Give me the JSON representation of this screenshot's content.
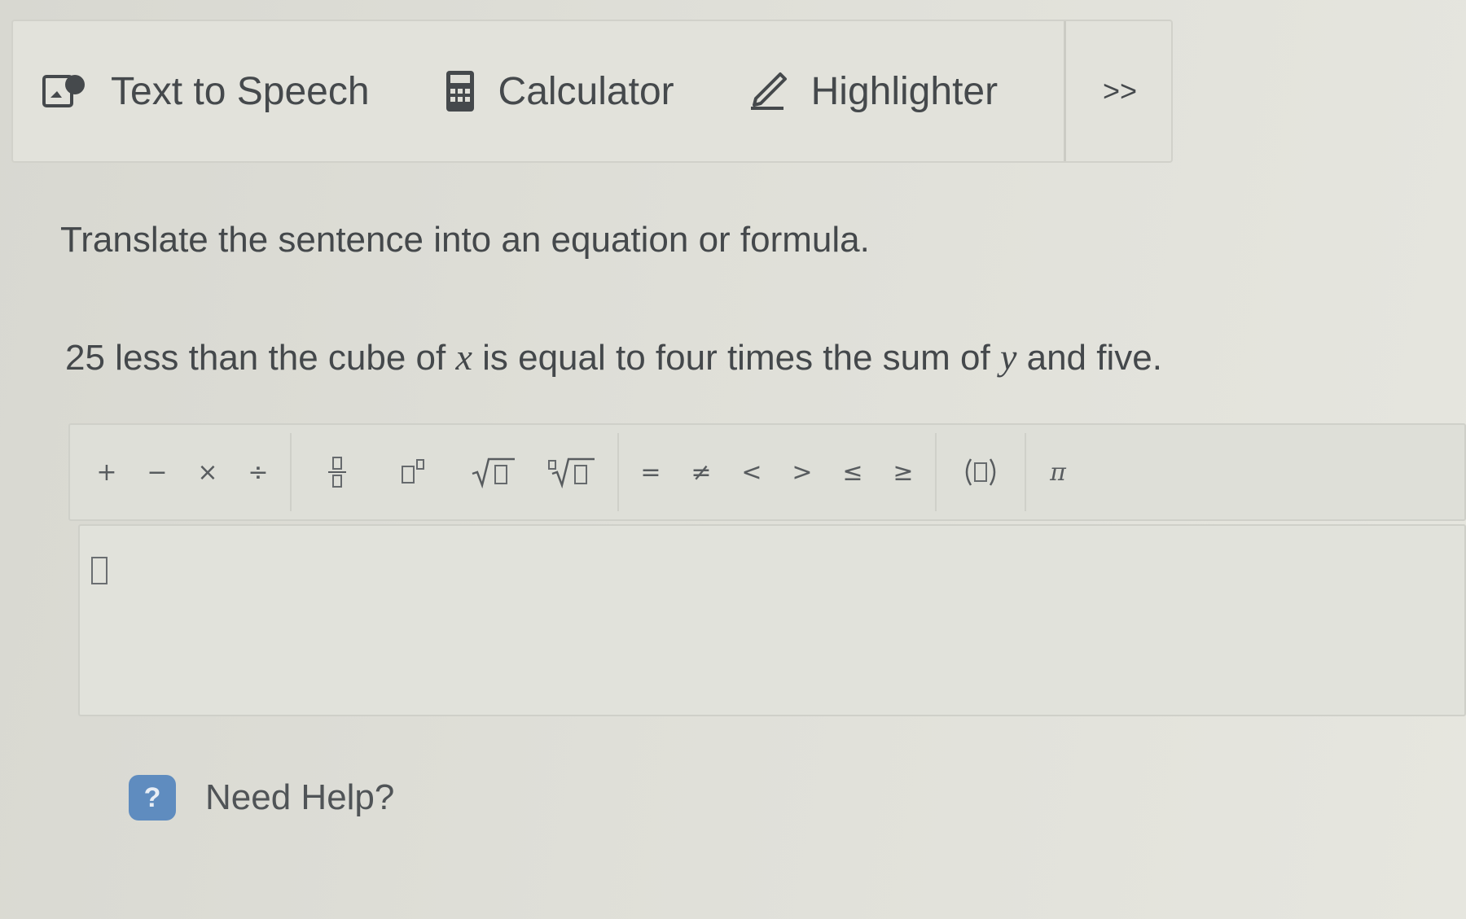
{
  "toolbar": {
    "items": [
      {
        "label": "Text to Speech",
        "icon": "speaker-icon"
      },
      {
        "label": "Calculator",
        "icon": "calculator-icon"
      },
      {
        "label": "Highlighter",
        "icon": "pen-icon"
      }
    ],
    "more_label": ">>"
  },
  "question": {
    "instruction": "Translate the sentence into an equation or formula.",
    "problem_parts": [
      "25 less than the cube of ",
      "x",
      " is equal to four times the sum of ",
      "y",
      " and five."
    ]
  },
  "palette": {
    "ops": [
      "+",
      "−",
      "×",
      "÷"
    ],
    "relations": [
      "=",
      "≠",
      "<",
      ">",
      "≤",
      "≥"
    ],
    "pi": "π"
  },
  "help": {
    "label": "Need Help?",
    "icon_glyph": "?"
  }
}
